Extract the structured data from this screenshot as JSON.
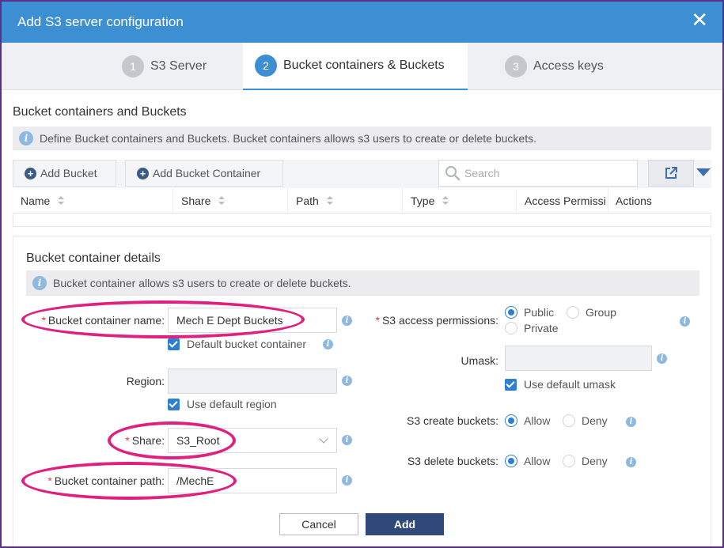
{
  "dialog": {
    "title": "Add S3 server configuration",
    "close_glyph": "✕"
  },
  "steps": [
    {
      "num": "1",
      "label": "S3 Server"
    },
    {
      "num": "2",
      "label": "Bucket containers & Buckets"
    },
    {
      "num": "3",
      "label": "Access keys"
    }
  ],
  "section": {
    "title": "Bucket containers and Buckets",
    "info": "Define Bucket containers and Buckets. Bucket containers allows s3 users to create or delete buckets."
  },
  "toolbar": {
    "add_bucket": "Add Bucket",
    "add_container": "Add Bucket Container",
    "search_placeholder": "Search"
  },
  "table": {
    "columns": [
      "Name",
      "Share",
      "Path",
      "Type",
      "Access Permissi",
      "Actions"
    ]
  },
  "details": {
    "title": "Bucket container details",
    "info": "Bucket container allows s3 users to create or delete buckets.",
    "container_name_label": "Bucket container name",
    "container_name_value": "Mech E Dept Buckets",
    "default_container_label": "Default bucket container",
    "region_label": "Region",
    "region_value": "",
    "use_default_region_label": "Use default region",
    "share_label": "Share",
    "share_value": "S3_Root",
    "path_label": "Bucket container path",
    "path_value": "/MechE",
    "access_label": "S3 access permissions",
    "access_options": [
      "Public",
      "Group",
      "Private"
    ],
    "umask_label": "Umask",
    "umask_value": "",
    "use_default_umask_label": "Use default umask",
    "create_label": "S3 create buckets",
    "delete_label": "S3 delete buckets",
    "allow_label": "Allow",
    "deny_label": "Deny"
  },
  "footer": {
    "cancel": "Cancel",
    "add": "Add"
  },
  "colors": {
    "accent": "#3d8fd4",
    "highlight": "#e0207f",
    "primary_button": "#2f4a78",
    "frame": "#5b2e8e"
  }
}
